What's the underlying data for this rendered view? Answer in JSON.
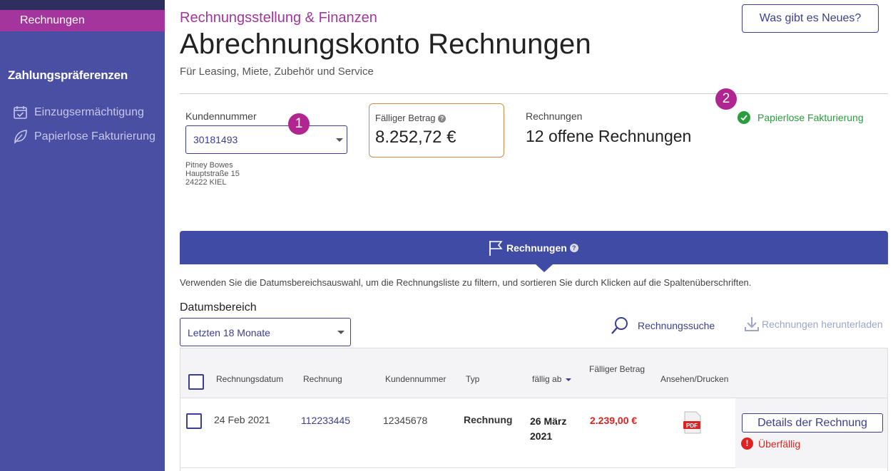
{
  "sidebar": {
    "active_item": "Rechnungen",
    "section_title": "Zahlungspräferenzen",
    "items": [
      {
        "label": "Einzugsermächtigung",
        "icon": "calendar-check-icon"
      },
      {
        "label": "Papierlose Fakturierung",
        "icon": "leaf-icon"
      }
    ]
  },
  "header": {
    "eyebrow": "Rechnungsstellung & Finanzen",
    "title": "Abrechnungskonto Rechnungen",
    "subtitle": "Für Leasing, Miete, Zubehör und Service",
    "news_button": "Was gibt es Neues?"
  },
  "account": {
    "customer_label": "Kundennummer",
    "customer_number": "30181493",
    "address": [
      "Pitney Bowes",
      "Hauptstraße 15",
      "24222 KIEL"
    ],
    "due_label": "Fälliger Betrag",
    "due_amount": "8.252,72 €",
    "invoices_label": "Rechnungen",
    "invoices_count": "12 offene Rechnungen",
    "paperless_status": "Papierlose Fakturierung"
  },
  "badges": {
    "one": "1",
    "two": "2"
  },
  "tab": {
    "label": "Rechnungen",
    "help": "?"
  },
  "filters": {
    "help_text": "Verwenden Sie die Datumsbereichsauswahl, um die Rechnungsliste zu filtern, und sortieren Sie durch Klicken auf die Spaltenüberschriften.",
    "range_label": "Datumsbereich",
    "range_value": "Letzten 18 Monate",
    "search_link": "Rechnungssuche",
    "download_link": "Rechnungen herunterladen"
  },
  "table": {
    "headers": {
      "date": "Rechnungsdatum",
      "invoice": "Rechnung",
      "customer": "Kundennummer",
      "type": "Typ",
      "due": "fällig ab",
      "amount": "Fälliger Betrag",
      "view": "Ansehen/Drucken"
    },
    "rows": [
      {
        "date": "24 Feb 2021",
        "invoice": "112233445",
        "customer": "12345678",
        "type": "Rechnung",
        "due_line1": "26 März",
        "due_line2": "2021",
        "amount": "2.239,00 €",
        "pdf": "PDF",
        "details_button": "Details der Rechnung",
        "status": "Überfällig"
      }
    ]
  },
  "colors": {
    "sidebar": "#4a4fa3",
    "accent": "#a3359c",
    "primary": "#3b3f8f",
    "success": "#2a9d3e",
    "danger": "#dd2222"
  }
}
